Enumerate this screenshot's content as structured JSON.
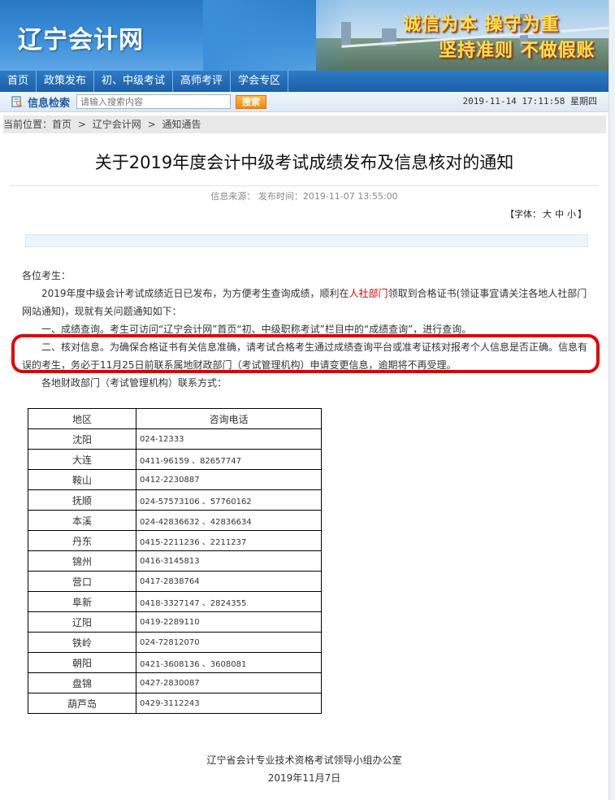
{
  "header": {
    "site_name": "辽宁会计网",
    "slogan_1": "诚信为本 操守为重",
    "slogan_2": "坚持准则 不做假账"
  },
  "nav": [
    "首页",
    "政策发布",
    "初、中级考试",
    "高师考评",
    "学会专区"
  ],
  "search": {
    "label": "信息检索",
    "placeholder": "请输入搜索内容",
    "button": "搜索",
    "datetime": "2019-11-14  17:11:58  星期四"
  },
  "breadcrumb": {
    "prefix": "当前位置：",
    "items": [
      "首页",
      ">",
      "辽宁会计网",
      ">",
      "通知通告"
    ]
  },
  "article": {
    "title": "关于2019年度会计中级考试成绩发布及信息核对的通知",
    "meta": "信息来源：  发布时间：2019-11-07 13:55:00",
    "font_label": "【字体：",
    "font_sizes": [
      "大",
      "中",
      "小"
    ],
    "font_close": "】",
    "greeting": "各位考生：",
    "para1_a": "2019年度中级会计考试成绩近日已发布，为方便考生查询成绩，顺利在",
    "para1_link": "人社部门",
    "para1_b": "领取到合格证书(领证事宜请关注各地人社部门网站通知)，现就有关问题通知如下：",
    "para2": "一、成绩查询。考生可访问“辽宁会计网”首页“初、中级职称考试”栏目中的“成绩查询”，进行查询。",
    "para3": "二、核对信息。为确保合格证书有关信息准确，请考试合格考生通过成绩查询平台或准考证核对报考个人信息是否正确。信息有误的考生，务必于11月25日前联系属地财政部门（考试管理机构）申请变更信息，逾期将不再受理。",
    "para4": "各地财政部门（考试管理机构）联系方式：",
    "signature_org": "辽宁省会计专业技术资格考试领导小组办公室",
    "signature_date": "2019年11月7日"
  },
  "table": {
    "headers": [
      "地区",
      "咨询电话"
    ],
    "rows": [
      [
        "沈阳",
        "024-12333"
      ],
      [
        "大连",
        "0411-96159 、82657747"
      ],
      [
        "鞍山",
        "0412-2230887"
      ],
      [
        "抚顺",
        "024-57573106 、57760162"
      ],
      [
        "本溪",
        "024-42836632 、42836634"
      ],
      [
        "丹东",
        "0415-2211236 、2211237"
      ],
      [
        "锦州",
        "0416-3145813"
      ],
      [
        "营口",
        "0417-2838764"
      ],
      [
        "阜新",
        "0418-3327147 、2824355"
      ],
      [
        "辽阳",
        "0419-2289110"
      ],
      [
        "铁岭",
        "024-72812070"
      ],
      [
        "朝阳",
        "0421-3608136 、3608081"
      ],
      [
        "盘锦",
        "0427-2830087"
      ],
      [
        "葫芦岛",
        "0429-3112243"
      ]
    ]
  },
  "colors": {
    "nav_blue": "#1c5fa6",
    "highlight_red": "#e10000",
    "slogan_yellow": "#ffe14d"
  }
}
